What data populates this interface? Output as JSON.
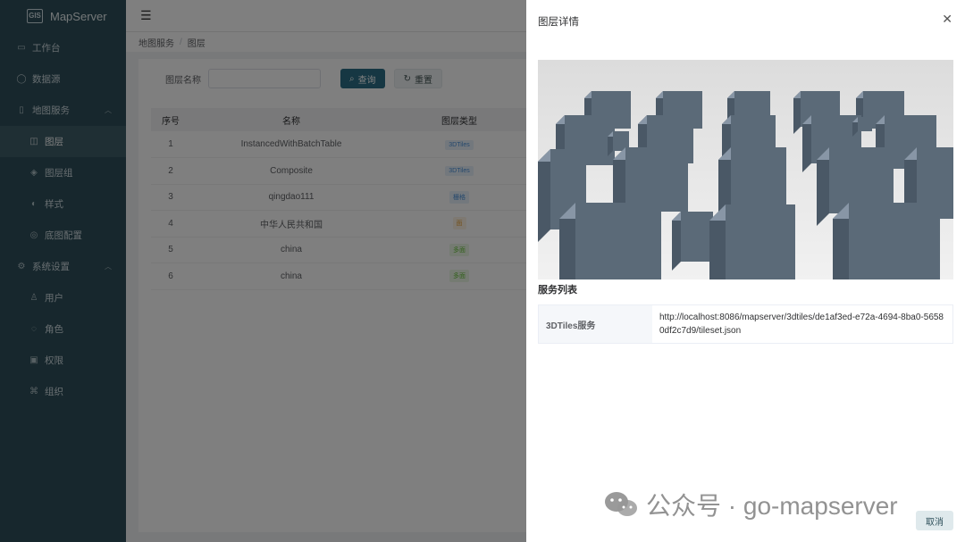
{
  "app": {
    "logo_box": "GIS",
    "title": "MapServer"
  },
  "sidebar": {
    "items": [
      {
        "label": "工作台",
        "icon": "dashboard-icon"
      },
      {
        "label": "数据源",
        "icon": "database-icon"
      },
      {
        "label": "地图服务",
        "icon": "phone-icon"
      },
      {
        "label": "图层",
        "icon": "map-icon"
      },
      {
        "label": "图层组",
        "icon": "layers-icon"
      },
      {
        "label": "样式",
        "icon": "brush-icon"
      },
      {
        "label": "底图配置",
        "icon": "basemap-icon"
      },
      {
        "label": "系统设置",
        "icon": "gear-icon"
      },
      {
        "label": "用户",
        "icon": "user-icon"
      },
      {
        "label": "角色",
        "icon": "role-icon"
      },
      {
        "label": "权限",
        "icon": "permission-icon"
      },
      {
        "label": "组织",
        "icon": "org-icon"
      }
    ]
  },
  "breadcrumb": {
    "root": "地图服务",
    "current": "图层"
  },
  "search": {
    "label": "图层名称",
    "value": "",
    "query_button": "查询",
    "reset_button": "重置"
  },
  "table": {
    "headers": [
      "序号",
      "名称",
      "图层类型"
    ],
    "rows": [
      {
        "index": "1",
        "name": "InstancedWithBatchTable",
        "type": "3DTiles",
        "color": "#4a90d9"
      },
      {
        "index": "2",
        "name": "Composite",
        "type": "3DTiles",
        "color": "#4a90d9"
      },
      {
        "index": "3",
        "name": "qingdao111",
        "type": "栅格",
        "color": "#4a90d9"
      },
      {
        "index": "4",
        "name": "中华人民共和国",
        "type": "面",
        "color": "#e6a23c"
      },
      {
        "index": "5",
        "name": "china",
        "type": "多面",
        "color": "#67c23a"
      },
      {
        "index": "6",
        "name": "china",
        "type": "多面",
        "color": "#67c23a"
      }
    ]
  },
  "drawer": {
    "title": "图层详情",
    "section_title": "服务列表",
    "service_label": "3DTiles服务",
    "service_url": "http://localhost:8086/mapserver/3dtiles/de1af3ed-e72a-4694-8ba0-56580df2c7d9/tileset.json",
    "cancel_button": "取消"
  },
  "watermark": {
    "text": "公众号 · go-mapserver"
  },
  "colors": {
    "sidebar": "#2f4f5a",
    "primary": "#2d6f86"
  }
}
